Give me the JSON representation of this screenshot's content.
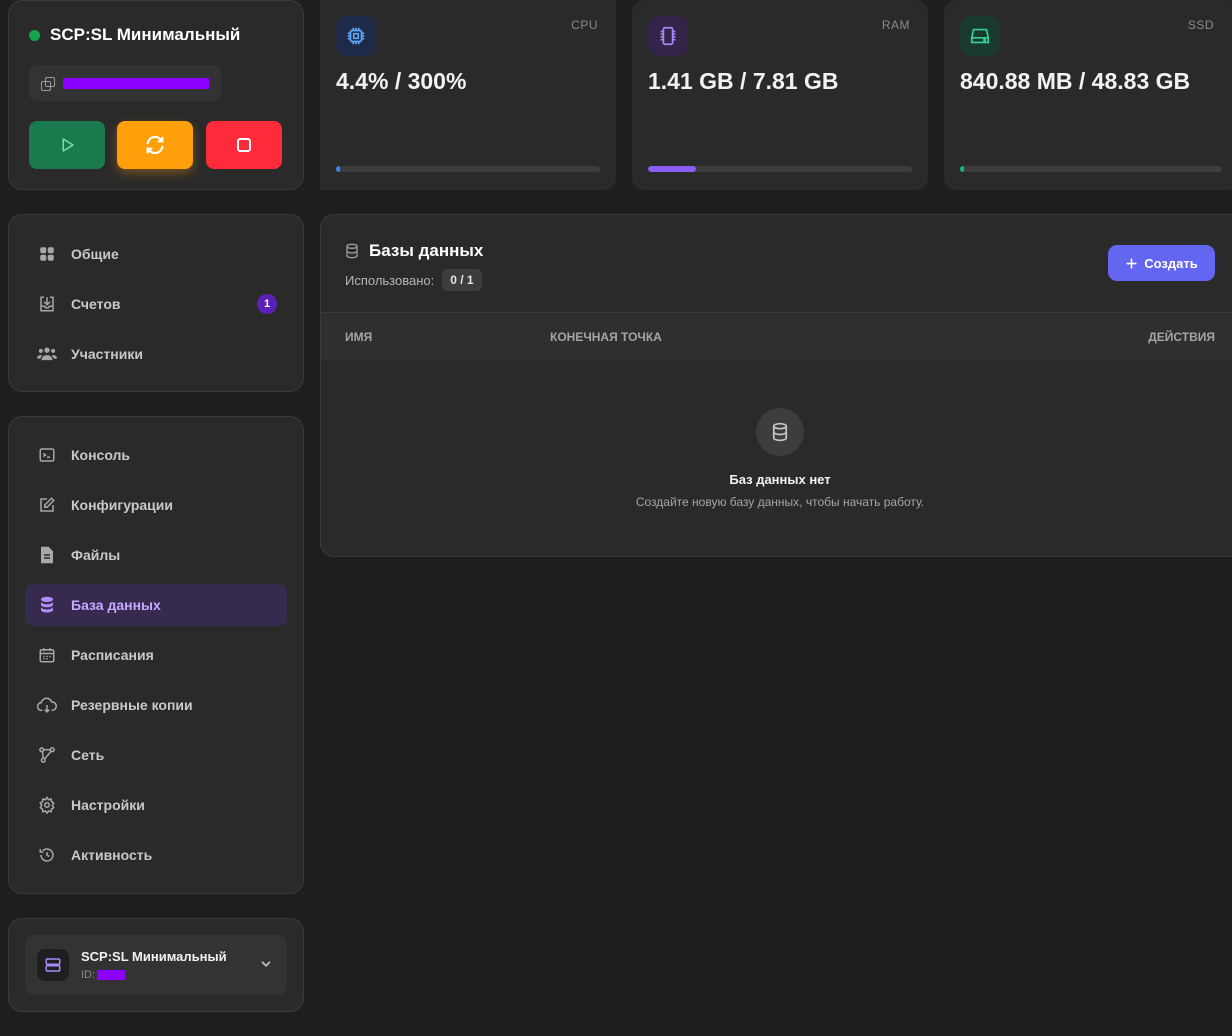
{
  "server": {
    "name": "SCP:SL Минимальный",
    "status_color": "#16a34a"
  },
  "controls": {
    "start_icon": "play-icon",
    "restart_icon": "refresh-icon",
    "stop_icon": "stop-icon"
  },
  "stats": {
    "cpu": {
      "label": "CPU",
      "value": "4.4% / 300%",
      "usage_fraction": 0.015,
      "color": "#3b82f6"
    },
    "ram": {
      "label": "RAM",
      "value": "1.41 GB / 7.81 GB",
      "usage_fraction": 0.18,
      "color": "#8b5cf6"
    },
    "ssd": {
      "label": "SSD",
      "value": "840.88 MB / 48.83 GB",
      "usage_fraction": 0.017,
      "color": "#10b981"
    }
  },
  "nav_top": [
    {
      "label": "Общие",
      "icon": "grid-icon"
    },
    {
      "label": "Счетов",
      "icon": "download-box-icon",
      "badge": "1"
    },
    {
      "label": "Участники",
      "icon": "users-icon"
    }
  ],
  "nav_main": [
    {
      "label": "Консоль",
      "icon": "terminal-icon"
    },
    {
      "label": "Конфигурации",
      "icon": "edit-icon"
    },
    {
      "label": "Файлы",
      "icon": "file-icon"
    },
    {
      "label": "База данных",
      "icon": "database-icon",
      "active": true
    },
    {
      "label": "Расписания",
      "icon": "calendar-icon"
    },
    {
      "label": "Резервные копии",
      "icon": "cloud-backup-icon"
    },
    {
      "label": "Сеть",
      "icon": "network-icon"
    },
    {
      "label": "Настройки",
      "icon": "gear-icon"
    },
    {
      "label": "Активность",
      "icon": "history-icon"
    }
  ],
  "server_select": {
    "name": "SCP:SL Минимальный",
    "id_label": "ID:"
  },
  "databases": {
    "title": "Базы данных",
    "used_label": "Использовано:",
    "used_value": "0 / 1",
    "create_label": "Создать",
    "columns": {
      "name": "ИМЯ",
      "endpoint": "КОНЕЧНАЯ ТОЧКА",
      "actions": "ДЕЙСТВИЯ"
    },
    "empty_title": "Баз данных нет",
    "empty_subtitle": "Создайте новую базу данных, чтобы начать работу."
  }
}
